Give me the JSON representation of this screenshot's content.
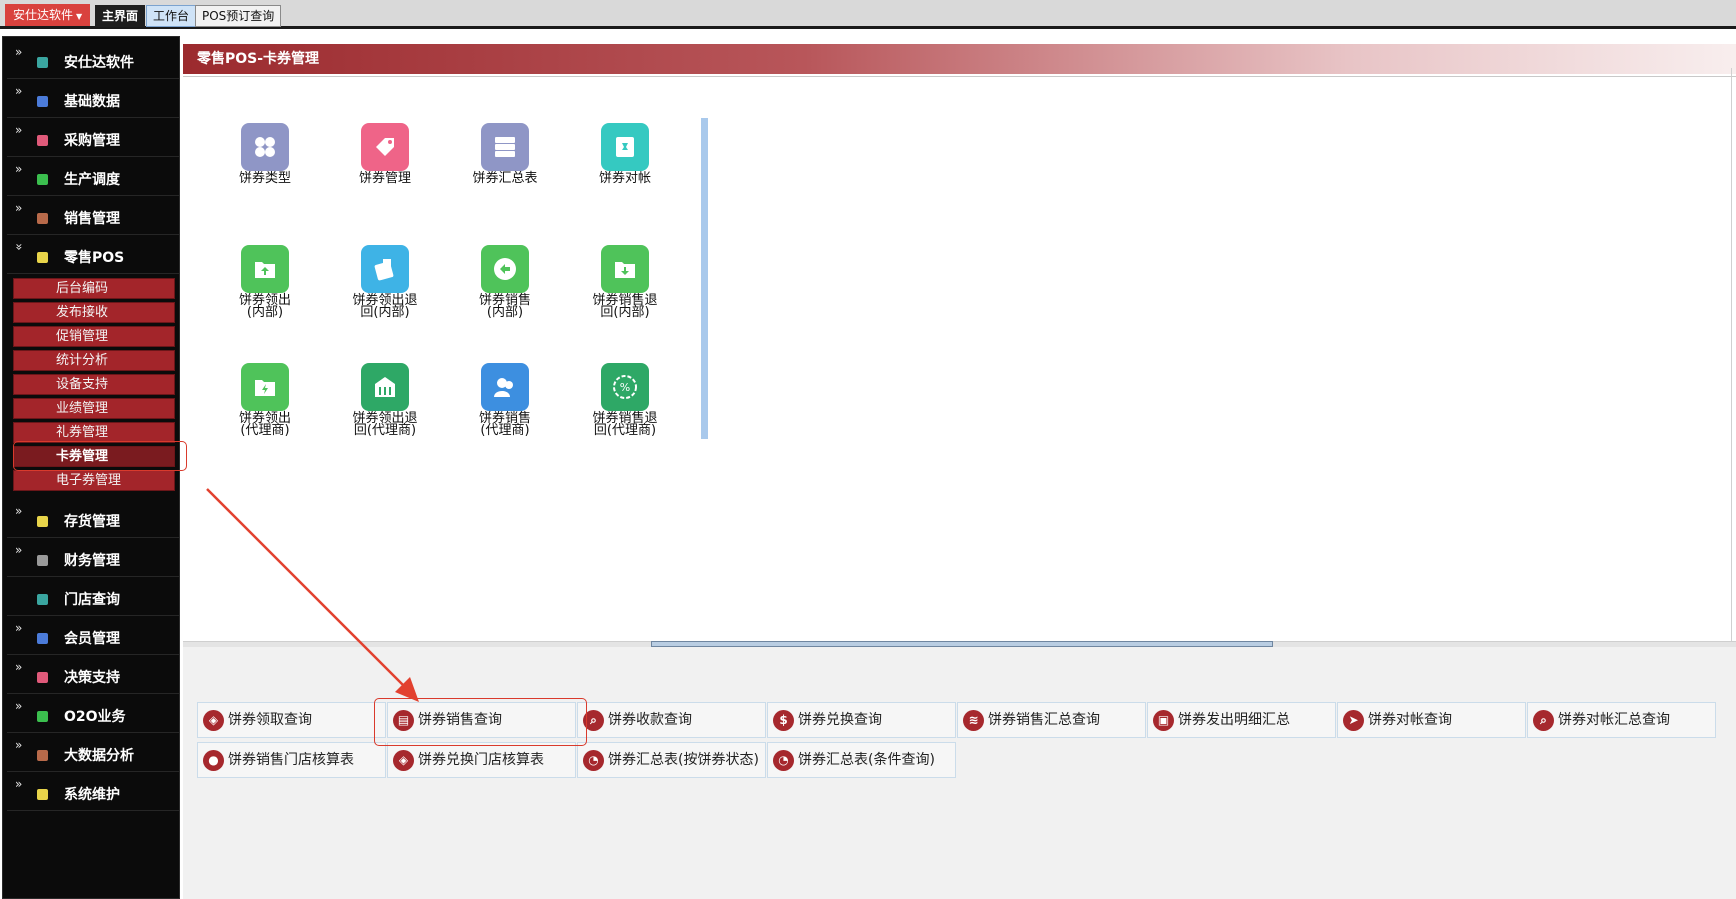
{
  "topbar": {
    "brand": "安仕达软件",
    "tabs": [
      {
        "label": "主界面",
        "state": "active"
      },
      {
        "label": "工作台",
        "state": "blue"
      },
      {
        "label": "POS预订查询",
        "state": "normal"
      }
    ]
  },
  "sidebar": {
    "items": [
      {
        "label": "安仕达软件",
        "icon": "teal-square-icon",
        "color": "#3aa6a0"
      },
      {
        "label": "基础数据",
        "icon": "blue-square-icon",
        "color": "#4b7bd9"
      },
      {
        "label": "采购管理",
        "icon": "pink-square-icon",
        "color": "#e05a7a"
      },
      {
        "label": "生产调度",
        "icon": "green-square-icon",
        "color": "#3bbf4e"
      },
      {
        "label": "销售管理",
        "icon": "brown-square-icon",
        "color": "#b86a4a"
      },
      {
        "label": "零售POS",
        "icon": "yellow-square-icon",
        "color": "#e8d44a"
      },
      {
        "label": "存货管理",
        "icon": "yellow-square-icon",
        "color": "#e8d44a"
      },
      {
        "label": "财务管理",
        "icon": "gray-square-icon",
        "color": "#9a9a9a"
      },
      {
        "label": "门店查询",
        "icon": "teal-square-icon",
        "color": "#3aa6a0"
      },
      {
        "label": "会员管理",
        "icon": "blue-square-icon",
        "color": "#4b7bd9"
      },
      {
        "label": "决策支持",
        "icon": "pink-square-icon",
        "color": "#e05a7a"
      },
      {
        "label": "O2O业务",
        "icon": "green-square-icon",
        "color": "#3bbf4e"
      },
      {
        "label": "大数据分析",
        "icon": "brown-square-icon",
        "color": "#b86a4a"
      },
      {
        "label": "系统维护",
        "icon": "yellow-square-icon",
        "color": "#e8d44a"
      }
    ],
    "pos_sub_items": [
      "后台编码",
      "发布接收",
      "促销管理",
      "统计分析",
      "设备支持",
      "业绩管理",
      "礼券管理",
      "卡券管理",
      "电子券管理"
    ],
    "selected_sub_item": "卡券管理"
  },
  "panel": {
    "title": "零售POS-卡券管理"
  },
  "apps": [
    {
      "label": "饼券类型",
      "color": "#8f96c6",
      "icon": "four-petal-icon"
    },
    {
      "label": "饼券管理",
      "color": "#ef6488",
      "icon": "tag-icon"
    },
    {
      "label": "饼券汇总表",
      "color": "#8f96c6",
      "icon": "server-icon"
    },
    {
      "label": "饼券对帐",
      "color": "#35c9c1",
      "icon": "pin-icon"
    },
    {
      "label": "饼券领出(内部)",
      "color": "#4fc35a",
      "icon": "folder-up-icon"
    },
    {
      "label": "饼券领出退回(内部)",
      "color": "#3eb3e6",
      "icon": "wallet-icon"
    },
    {
      "label": "饼券销售(内部)",
      "color": "#4fc35a",
      "icon": "undo-icon"
    },
    {
      "label": "饼券销售退回(内部)",
      "color": "#4fc35a",
      "icon": "folder-down-icon"
    },
    {
      "label": "饼券领出(代理商)",
      "color": "#4fc35a",
      "icon": "folder-bolt-icon"
    },
    {
      "label": "饼券领出退回(代理商)",
      "color": "#2ea866",
      "icon": "bank-icon"
    },
    {
      "label": "饼券销售(代理商)",
      "color": "#3d8fe0",
      "icon": "users-icon"
    },
    {
      "label": "饼券销售退回(代理商)",
      "color": "#2ea866",
      "icon": "percent-badge-icon"
    }
  ],
  "reports": [
    {
      "label": "饼券领取查询",
      "icon": "tag-icon"
    },
    {
      "label": "饼券销售查询",
      "icon": "document-icon"
    },
    {
      "label": "饼券收款查询",
      "icon": "search-icon"
    },
    {
      "label": "饼券兑换查询",
      "icon": "dollar-icon"
    },
    {
      "label": "饼券销售汇总查询",
      "icon": "layers-icon"
    },
    {
      "label": "饼券发出明细汇总",
      "icon": "contact-card-icon"
    },
    {
      "label": "饼券对帐查询",
      "icon": "send-icon"
    },
    {
      "label": "饼券对帐汇总查询",
      "icon": "search-icon"
    },
    {
      "label": "饼券销售门店核算表",
      "icon": "user-pin-icon"
    },
    {
      "label": "饼券兑换门店核算表",
      "icon": "tag-icon"
    },
    {
      "label": "饼券汇总表(按饼券状态)",
      "icon": "pie-chart-icon"
    },
    {
      "label": "饼券汇总表(条件查询)",
      "icon": "pie-chart-icon"
    }
  ],
  "annotation_color": "#d93a2c"
}
